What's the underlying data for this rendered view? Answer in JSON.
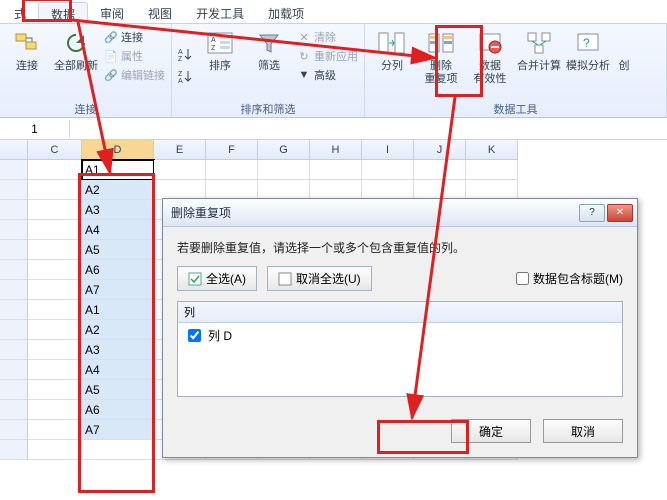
{
  "tabs": {
    "t0": "式",
    "t1": "数据",
    "t2": "审阅",
    "t3": "视图",
    "t4": "开发工具",
    "t5": "加载项"
  },
  "ribbon": {
    "group_conn": "连接",
    "group_sort": "排序和筛选",
    "group_data": "数据工具",
    "btn_conn_mgr": "连接",
    "btn_refresh": "全部刷新",
    "small_conn": "连接",
    "small_prop": "属性",
    "small_editlink": "编辑链接",
    "btn_sort": "排序",
    "btn_filter": "筛选",
    "small_clear": "清除",
    "small_reapply": "重新应用",
    "small_adv": "高级",
    "btn_texttocol": "分列",
    "btn_removedup": "删除",
    "btn_removedup2": "重复项",
    "btn_validation": "数据",
    "btn_validation2": "有效性",
    "btn_consolidate": "合并计算",
    "btn_whatif": "模拟分析",
    "btn_x": "创"
  },
  "fbar_name": "1",
  "columns": [
    "C",
    "D",
    "E",
    "F",
    "G",
    "H",
    "I",
    "J",
    "K"
  ],
  "colD_values": [
    "A1",
    "A2",
    "A3",
    "A4",
    "A5",
    "A6",
    "A7",
    "A1",
    "A2",
    "A3",
    "A4",
    "A5",
    "A6",
    "A7"
  ],
  "dialog": {
    "title": "删除重复项",
    "msg": "若要删除重复值，请选择一个或多个包含重复值的列。",
    "select_all": "全选(A)",
    "unselect_all": "取消全选(U)",
    "headers_chk": "数据包含标题(M)",
    "list_header": "列",
    "list_item": "列 D",
    "ok": "确定",
    "cancel": "取消"
  }
}
